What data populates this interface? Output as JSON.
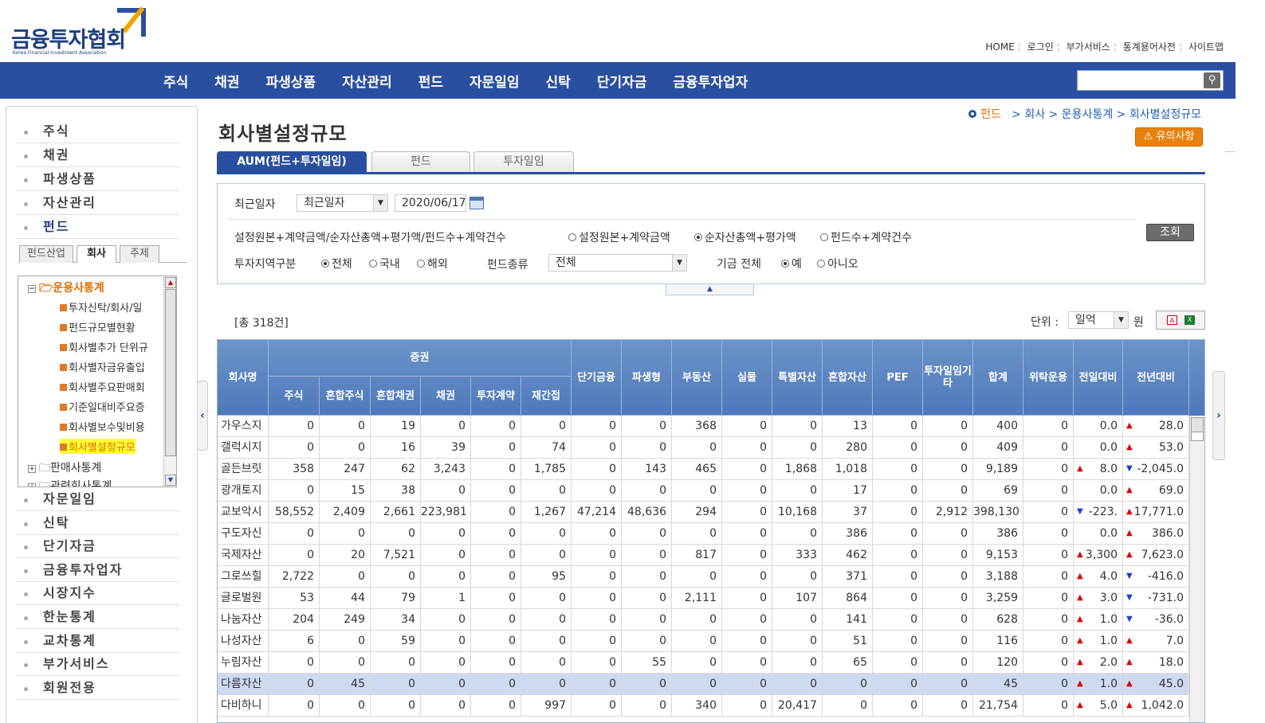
{
  "header": {
    "logo_text": "금융투자협회",
    "logo_sub": "Korea Financial Investment Association",
    "top_links": [
      "HOME",
      "로그인",
      "부가서비스",
      "통계용어사전",
      "사이트맵"
    ]
  },
  "gnb": [
    "주식",
    "채권",
    "파생상품",
    "자산관리",
    "펀드",
    "자문일임",
    "신탁",
    "단기자금",
    "금융투자업자"
  ],
  "sidebar": {
    "items": [
      "주식",
      "채권",
      "파생상품",
      "자산관리",
      "펀드",
      "자문일임",
      "신탁",
      "단기자금",
      "금융투자업자",
      "시장지수",
      "한눈통계",
      "교차통계",
      "부가서비스",
      "회원전용"
    ],
    "tabs": [
      "펀드산업",
      "회사",
      "주제"
    ],
    "tree_root": "운용사통계",
    "tree_children": [
      "투자신탁/회사/일",
      "펀드규모별현황",
      "회사별추가 단위규",
      "회사별자금유출입",
      "회사별주요판매회",
      "기준일대비주요증",
      "회사별보수및비용",
      "회사별설정규모"
    ],
    "tree_siblings": [
      "판매사통계",
      "관련회사통계"
    ]
  },
  "breadcrumb": {
    "home": "펀드",
    "path": "> 회사 > 운용사통계 > 회사별설정규모"
  },
  "page": {
    "title": "회사별설정규모",
    "notice": "⚠ 유의사항",
    "tabs": [
      "AUM(펀드+투자일임)",
      "펀드",
      "투자일임"
    ]
  },
  "filter": {
    "date_label": "최근일자",
    "date_select": "최근일자",
    "date_value": "2020/06/17",
    "metric_label": "설정원본+계약금액/순자산총액+평가액/펀드수+계약건수",
    "metric_options": [
      "설정원본+계약금액",
      "순자산총액+평가액",
      "펀드수+계약건수"
    ],
    "region_label": "투자지역구분",
    "region_options": [
      "전체",
      "국내",
      "해외"
    ],
    "fund_type_label": "펀드종류",
    "fund_type_value": "전체",
    "fund_all_label": "기금 전체",
    "fund_all_options": [
      "예",
      "아니오"
    ],
    "query_button": "조회"
  },
  "result": {
    "total": "[총 318건]",
    "unit_label": "단위 :",
    "unit_value": "일억",
    "unit_won": "원"
  },
  "table": {
    "group_header": "증권",
    "headers": [
      "회사명",
      "주식",
      "혼합주식",
      "혼합채권",
      "채권",
      "투자계약",
      "재간접",
      "단기금융",
      "파생형",
      "부동산",
      "실물",
      "특별자산",
      "혼합자산",
      "PEF",
      "투자일임기타",
      "합계",
      "위탁운용",
      "전일대비",
      "전년대비"
    ],
    "rows": [
      {
        "name": "가우스지",
        "v": [
          "0",
          "0",
          "19",
          "0",
          "0",
          "0",
          "0",
          "0",
          "368",
          "0",
          "0",
          "13",
          "0",
          "0",
          "400",
          "0"
        ],
        "d1": "0.0",
        "d1dir": "",
        "d2": "28.0",
        "d2dir": "up"
      },
      {
        "name": "갤럭시지",
        "v": [
          "0",
          "0",
          "16",
          "39",
          "0",
          "74",
          "0",
          "0",
          "0",
          "0",
          "0",
          "280",
          "0",
          "0",
          "409",
          "0"
        ],
        "d1": "0.0",
        "d1dir": "",
        "d2": "53.0",
        "d2dir": "up"
      },
      {
        "name": "골든브릿",
        "v": [
          "358",
          "247",
          "62",
          "3,243",
          "0",
          "1,785",
          "0",
          "143",
          "465",
          "0",
          "1,868",
          "1,018",
          "0",
          "0",
          "9,189",
          "0"
        ],
        "d1": "8.0",
        "d1dir": "up",
        "d2": "-2,045.0",
        "d2dir": "down"
      },
      {
        "name": "광개토지",
        "v": [
          "0",
          "15",
          "38",
          "0",
          "0",
          "0",
          "0",
          "0",
          "0",
          "0",
          "0",
          "17",
          "0",
          "0",
          "69",
          "0"
        ],
        "d1": "0.0",
        "d1dir": "",
        "d2": "69.0",
        "d2dir": "up"
      },
      {
        "name": "교보악시",
        "v": [
          "58,552",
          "2,409",
          "2,661",
          "223,981",
          "0",
          "1,267",
          "47,214",
          "48,636",
          "294",
          "0",
          "10,168",
          "37",
          "0",
          "2,912",
          "398,130",
          "0"
        ],
        "d1": "-223.",
        "d1dir": "down",
        "d2": "17,771.0",
        "d2dir": "up"
      },
      {
        "name": "구도자신",
        "v": [
          "0",
          "0",
          "0",
          "0",
          "0",
          "0",
          "0",
          "0",
          "0",
          "0",
          "0",
          "386",
          "0",
          "0",
          "386",
          "0"
        ],
        "d1": "0.0",
        "d1dir": "",
        "d2": "386.0",
        "d2dir": "up"
      },
      {
        "name": "국제자산",
        "v": [
          "0",
          "20",
          "7,521",
          "0",
          "0",
          "0",
          "0",
          "0",
          "817",
          "0",
          "333",
          "462",
          "0",
          "0",
          "9,153",
          "0"
        ],
        "d1": "3,300",
        "d1dir": "up",
        "d2": "7,623.0",
        "d2dir": "up"
      },
      {
        "name": "그로쓰힐",
        "v": [
          "2,722",
          "0",
          "0",
          "0",
          "0",
          "95",
          "0",
          "0",
          "0",
          "0",
          "0",
          "371",
          "0",
          "0",
          "3,188",
          "0"
        ],
        "d1": "4.0",
        "d1dir": "up",
        "d2": "-416.0",
        "d2dir": "down"
      },
      {
        "name": "글로벌원",
        "v": [
          "53",
          "44",
          "79",
          "1",
          "0",
          "0",
          "0",
          "0",
          "2,111",
          "0",
          "107",
          "864",
          "0",
          "0",
          "3,259",
          "0"
        ],
        "d1": "3.0",
        "d1dir": "up",
        "d2": "-731.0",
        "d2dir": "down"
      },
      {
        "name": "나눔자산",
        "v": [
          "204",
          "249",
          "34",
          "0",
          "0",
          "0",
          "0",
          "0",
          "0",
          "0",
          "0",
          "141",
          "0",
          "0",
          "628",
          "0"
        ],
        "d1": "1.0",
        "d1dir": "up",
        "d2": "-36.0",
        "d2dir": "down"
      },
      {
        "name": "나성자산",
        "v": [
          "6",
          "0",
          "59",
          "0",
          "0",
          "0",
          "0",
          "0",
          "0",
          "0",
          "0",
          "51",
          "0",
          "0",
          "116",
          "0"
        ],
        "d1": "1.0",
        "d1dir": "up",
        "d2": "7.0",
        "d2dir": "up"
      },
      {
        "name": "누림자산",
        "v": [
          "0",
          "0",
          "0",
          "0",
          "0",
          "0",
          "0",
          "55",
          "0",
          "0",
          "0",
          "65",
          "0",
          "0",
          "120",
          "0"
        ],
        "d1": "2.0",
        "d1dir": "up",
        "d2": "18.0",
        "d2dir": "up"
      },
      {
        "name": "다름자산",
        "v": [
          "0",
          "45",
          "0",
          "0",
          "0",
          "0",
          "0",
          "0",
          "0",
          "0",
          "0",
          "0",
          "0",
          "0",
          "45",
          "0"
        ],
        "d1": "1.0",
        "d1dir": "up",
        "d2": "45.0",
        "d2dir": "up",
        "selected": true
      },
      {
        "name": "다비하니",
        "v": [
          "0",
          "0",
          "0",
          "0",
          "0",
          "997",
          "0",
          "0",
          "340",
          "0",
          "20,417",
          "0",
          "0",
          "0",
          "21,754",
          "0"
        ],
        "d1": "5.0",
        "d1dir": "up",
        "d2": "1,042.0",
        "d2dir": "up"
      }
    ]
  }
}
